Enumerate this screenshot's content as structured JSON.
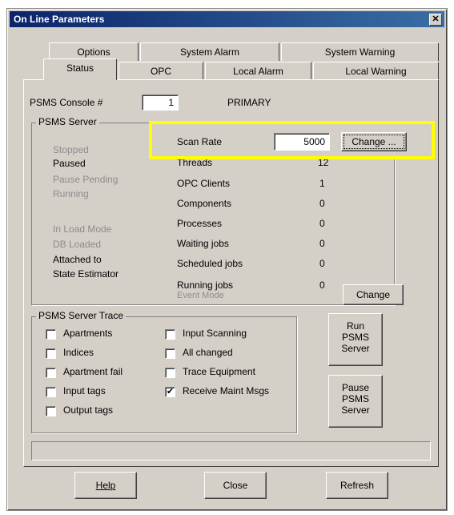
{
  "window": {
    "title": "On Line Parameters",
    "close_glyph": "✕"
  },
  "tabs": {
    "row1": [
      "Options",
      "System Alarm",
      "System Warning"
    ],
    "row2": [
      "Status",
      "OPC",
      "Local Alarm",
      "Local Warning"
    ],
    "active": "Status"
  },
  "console": {
    "label": "PSMS Console #",
    "value": "1",
    "role": "PRIMARY"
  },
  "server": {
    "group_title": "PSMS Server",
    "states": [
      {
        "label": "Stopped",
        "active": false
      },
      {
        "label": "Paused",
        "active": true
      },
      {
        "label": "Pause Pending",
        "active": false
      },
      {
        "label": "Running",
        "active": false
      }
    ],
    "load_states": [
      {
        "label": "In Load Mode",
        "active": false
      },
      {
        "label": "DB Loaded",
        "active": false
      },
      {
        "label": "Attached to",
        "active": true
      },
      {
        "label": "State Estimator",
        "active": true
      }
    ],
    "scan_rate": {
      "label": "Scan Rate",
      "value": "5000",
      "button": "Change ..."
    },
    "stats": [
      {
        "label": "Threads",
        "value": "12"
      },
      {
        "label": "OPC Clients",
        "value": "1"
      },
      {
        "label": "Components",
        "value": "0"
      },
      {
        "label": "Processes",
        "value": "0"
      },
      {
        "label": "Waiting jobs",
        "value": "0"
      },
      {
        "label": "Scheduled jobs",
        "value": "0"
      },
      {
        "label": "Running jobs",
        "value": "0"
      }
    ],
    "event_mode_label": "Event Mode",
    "change_button": "Change"
  },
  "trace": {
    "group_title": "PSMS Server Trace",
    "left": [
      {
        "label": "Apartments",
        "checked": false
      },
      {
        "label": "Indices",
        "checked": false
      },
      {
        "label": "Apartment fail",
        "checked": false
      },
      {
        "label": "Input tags",
        "checked": false
      },
      {
        "label": "Output tags",
        "checked": false
      }
    ],
    "right": [
      {
        "label": "Input Scanning",
        "checked": false
      },
      {
        "label": "All changed",
        "checked": false
      },
      {
        "label": "Trace Equipment",
        "checked": false
      },
      {
        "label": "Receive Maint Msgs",
        "checked": true
      }
    ]
  },
  "side_buttons": {
    "run": [
      "Run",
      "PSMS",
      "Server"
    ],
    "pause": [
      "Pause",
      "PSMS",
      "Server"
    ]
  },
  "footer": {
    "help": "Help",
    "close": "Close",
    "refresh": "Refresh"
  },
  "status_bar": "",
  "colors": {
    "titlebar": "#0a246a",
    "highlight": "#ffff00",
    "face": "#d4d0c8"
  }
}
